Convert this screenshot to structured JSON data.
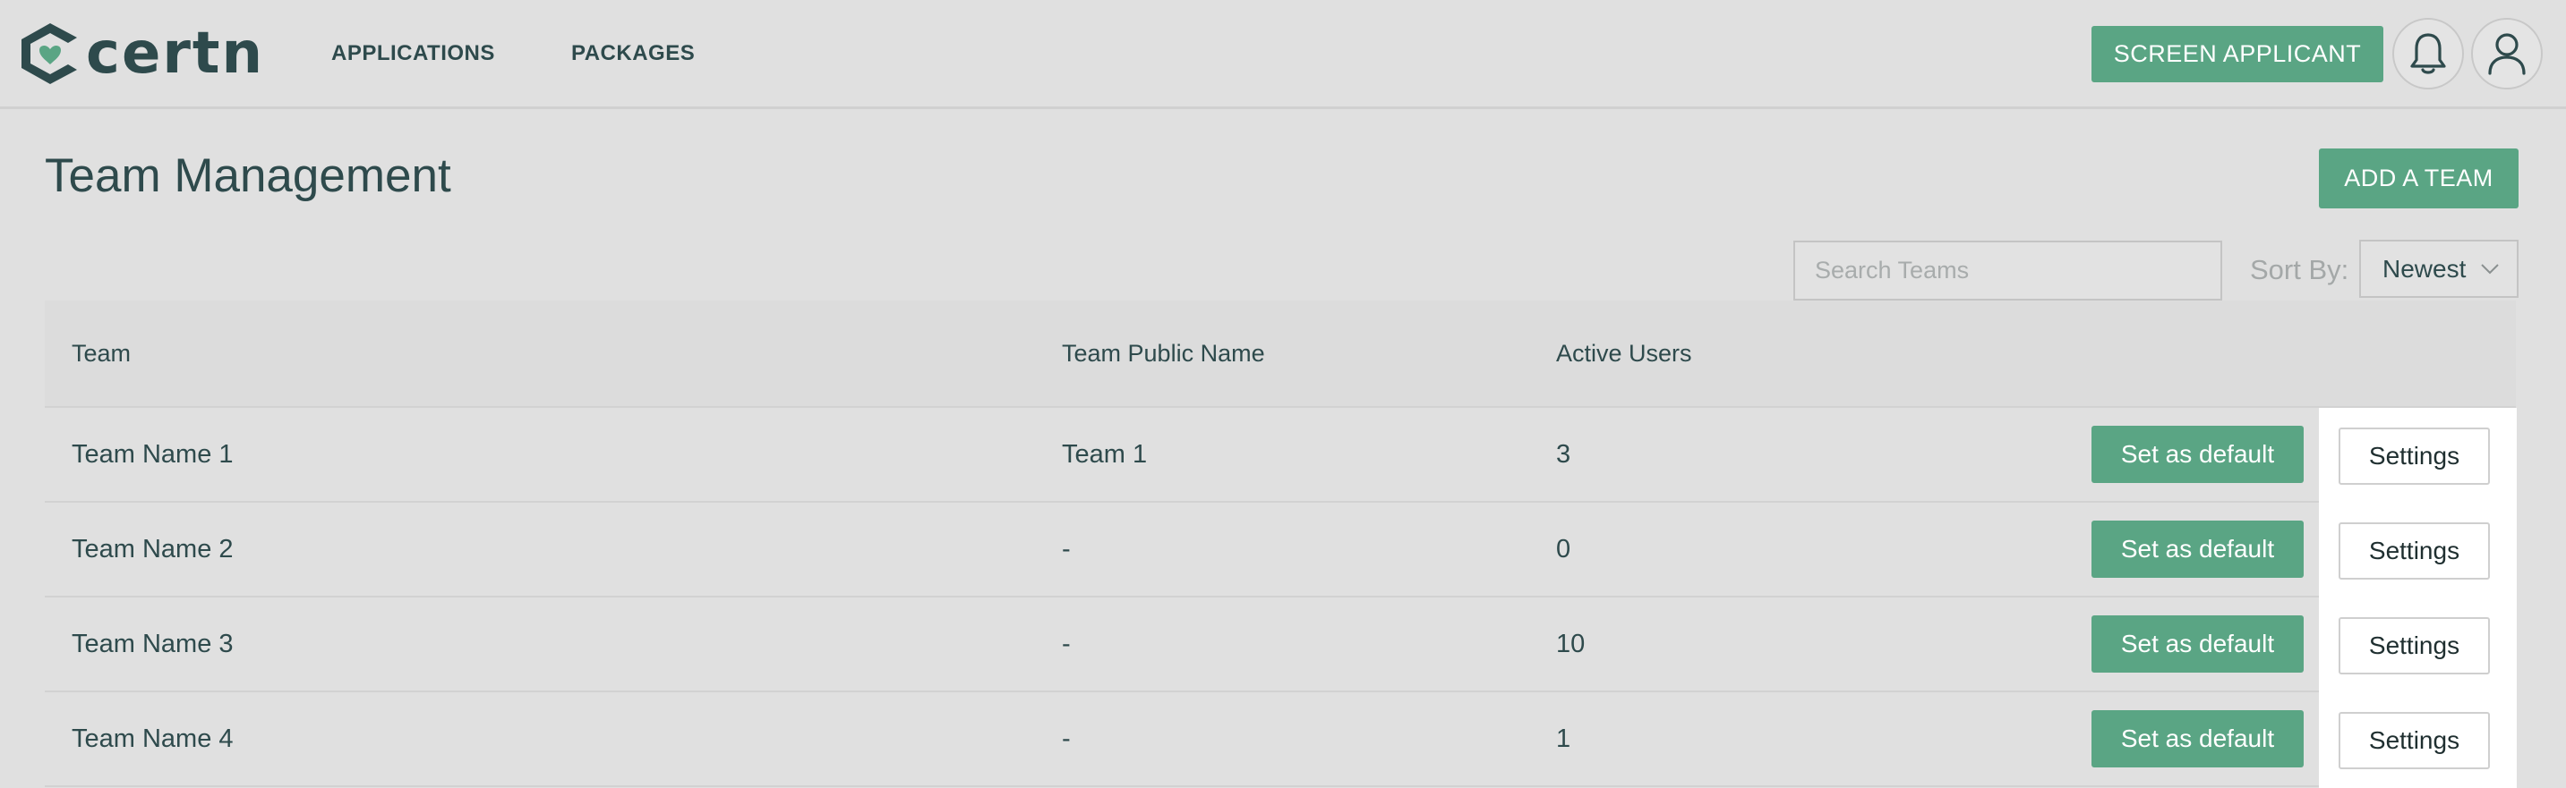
{
  "brand": {
    "name": "certn",
    "accent": "#5aa584",
    "text": "#2e4a4c"
  },
  "nav": {
    "items": [
      {
        "label": "APPLICATIONS"
      },
      {
        "label": "PACKAGES"
      }
    ],
    "screen_applicant_label": "SCREEN APPLICANT",
    "notifications_icon": "bell-icon",
    "profile_icon": "user-icon"
  },
  "page": {
    "title": "Team Management",
    "add_team_label": "ADD A TEAM"
  },
  "search": {
    "placeholder": "Search Teams",
    "value": ""
  },
  "sort": {
    "label": "Sort By:",
    "selected": "Newest"
  },
  "table": {
    "columns": [
      "Team",
      "Team Public Name",
      "Active Users"
    ],
    "rows": [
      {
        "team": "Team Name 1",
        "public_name": "Team 1",
        "active_users": "3"
      },
      {
        "team": "Team Name 2",
        "public_name": "-",
        "active_users": "0"
      },
      {
        "team": "Team Name 3",
        "public_name": "-",
        "active_users": "10"
      },
      {
        "team": "Team Name 4",
        "public_name": "-",
        "active_users": "1"
      }
    ],
    "default_label": "Set as default",
    "settings_label": "Settings"
  }
}
